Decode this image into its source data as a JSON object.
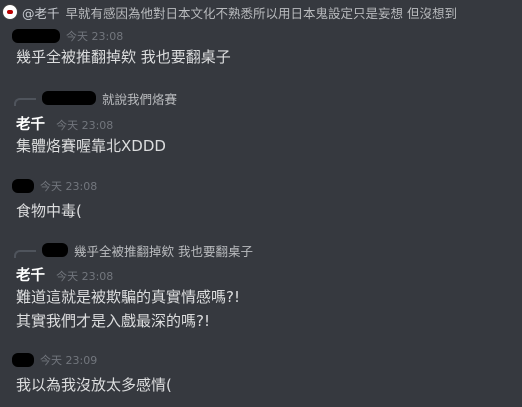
{
  "messages": [
    {
      "reply": {
        "author": "@老千",
        "text": "早就有感因為他對日本文化不熟悉所以用日本鬼設定只是妄想 但沒想到"
      },
      "timestamp": "今天 23:08",
      "lines": [
        "幾乎全被推翻掉欸 我也要翻桌子"
      ]
    },
    {
      "reply": {
        "text": "就說我們烙賽"
      },
      "author": "老千",
      "timestamp": "今天 23:08",
      "lines": [
        "集體烙賽喔靠北XDDD"
      ]
    },
    {
      "timestamp": "今天 23:08",
      "lines": [
        "食物中毒("
      ]
    },
    {
      "reply": {
        "text": "幾乎全被推翻掉欸 我也要翻桌子"
      },
      "author": "老千",
      "timestamp": "今天 23:08",
      "lines": [
        "難道這就是被欺騙的真實情感嗎?!",
        "其實我們才是入戲最深的嗎?!"
      ]
    },
    {
      "timestamp": "今天 23:09",
      "lines": [
        "我以為我沒放太多感情("
      ]
    }
  ]
}
